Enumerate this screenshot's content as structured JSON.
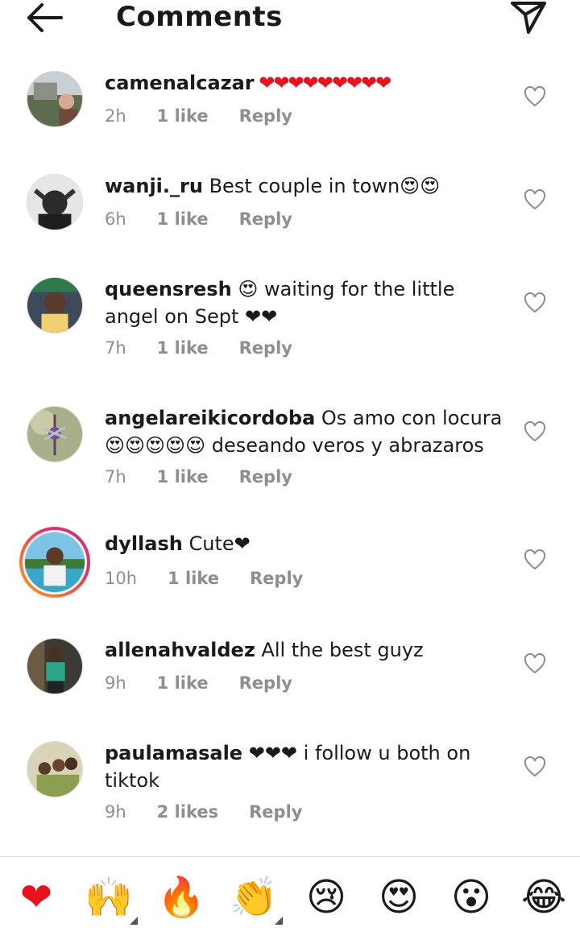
{
  "header": {
    "title": "Comments"
  },
  "comments": [
    {
      "user": "camenalcazar",
      "text": " ❤❤❤❤❤❤❤❤❤",
      "time": "2h",
      "likes": "1 like",
      "reply": "Reply"
    },
    {
      "user": "wanji._ru",
      "text": " Best couple in town😍😍",
      "time": "6h",
      "likes": "1 like",
      "reply": "Reply"
    },
    {
      "user": "queensresh",
      "text": " 😍 waiting for the little angel on Sept ❤❤",
      "time": "7h",
      "likes": "1 like",
      "reply": "Reply"
    },
    {
      "user": "angelareikicordoba",
      "text": " Os amo con locura😍😍😍😍😍 deseando veros y abrazaros",
      "time": "7h",
      "likes": "1 like",
      "reply": "Reply"
    },
    {
      "user": "dyllash",
      "text": " Cute❤",
      "time": "10h",
      "likes": "1 like",
      "reply": "Reply"
    },
    {
      "user": "allenahvaldez",
      "text": " All the best guyz",
      "time": "9h",
      "likes": "1 like",
      "reply": "Reply"
    },
    {
      "user": "paulamasale",
      "text": " ❤❤❤ i follow u both on tiktok",
      "time": "9h",
      "likes": "2 likes",
      "reply": "Reply"
    }
  ],
  "emoji_bar": [
    "❤",
    "🙌",
    "🔥",
    "👏",
    "😢",
    "😍",
    "😮",
    "😂"
  ],
  "colors": {
    "heart": "#e8121e",
    "meta": "#8e8e8e",
    "story_ring": "#e1306c"
  }
}
